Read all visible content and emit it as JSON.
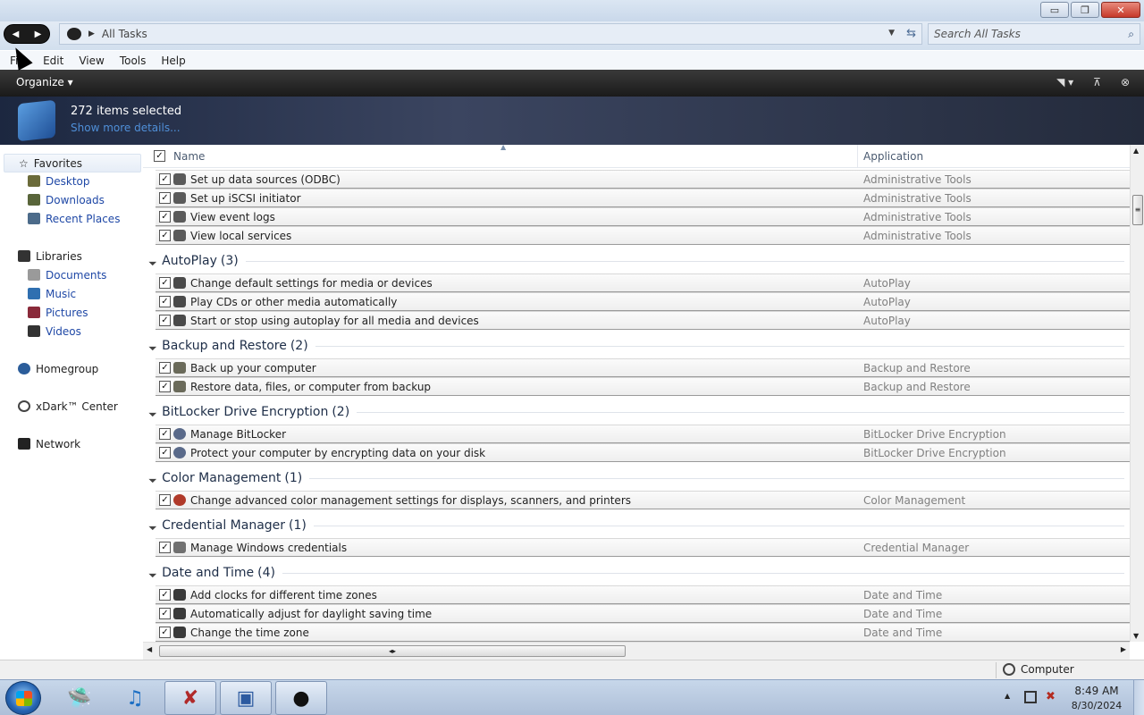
{
  "window": {
    "controls": {
      "minimize": "▭",
      "maximize": "❐",
      "close": "✕"
    }
  },
  "address": {
    "path": "All Tasks",
    "search_placeholder": "Search All Tasks"
  },
  "menu": [
    "File",
    "Edit",
    "View",
    "Tools",
    "Help"
  ],
  "toolbar": {
    "organize": "Organize"
  },
  "details": {
    "count": "272 items selected",
    "more": "Show more details..."
  },
  "sidebar": {
    "favorites": "Favorites",
    "fav_items": [
      "Desktop",
      "Downloads",
      "Recent Places"
    ],
    "libraries": "Libraries",
    "lib_items": [
      "Documents",
      "Music",
      "Pictures",
      "Videos"
    ],
    "homegroup": "Homegroup",
    "xdark": "xDark™ Center",
    "network": "Network"
  },
  "columns": {
    "name": "Name",
    "application": "Application"
  },
  "list": {
    "top_rows": [
      {
        "name": "Set up data sources (ODBC)",
        "app": "Administrative Tools"
      },
      {
        "name": "Set up iSCSI initiator",
        "app": "Administrative Tools"
      },
      {
        "name": "View event logs",
        "app": "Administrative Tools"
      },
      {
        "name": "View local services",
        "app": "Administrative Tools"
      }
    ],
    "groups": [
      {
        "label": "AutoPlay",
        "count": "(3)",
        "rows": [
          {
            "name": "Change default settings for media or devices",
            "app": "AutoPlay"
          },
          {
            "name": "Play CDs or other media automatically",
            "app": "AutoPlay"
          },
          {
            "name": "Start or stop using autoplay for all media and devices",
            "app": "AutoPlay"
          }
        ]
      },
      {
        "label": "Backup and Restore",
        "count": "(2)",
        "rows": [
          {
            "name": "Back up your computer",
            "app": "Backup and Restore"
          },
          {
            "name": "Restore data, files, or computer from backup",
            "app": "Backup and Restore"
          }
        ]
      },
      {
        "label": "BitLocker Drive Encryption",
        "count": "(2)",
        "rows": [
          {
            "name": "Manage BitLocker",
            "app": "BitLocker Drive Encryption"
          },
          {
            "name": "Protect your computer by encrypting data on your disk",
            "app": "BitLocker Drive Encryption"
          }
        ]
      },
      {
        "label": "Color Management",
        "count": "(1)",
        "rows": [
          {
            "name": "Change advanced color management settings for displays, scanners, and printers",
            "app": "Color Management"
          }
        ]
      },
      {
        "label": "Credential Manager",
        "count": "(1)",
        "rows": [
          {
            "name": "Manage Windows credentials",
            "app": "Credential Manager"
          }
        ]
      },
      {
        "label": "Date and Time",
        "count": "(4)",
        "rows": [
          {
            "name": "Add clocks for different time zones",
            "app": "Date and Time"
          },
          {
            "name": "Automatically adjust for daylight saving time",
            "app": "Date and Time"
          },
          {
            "name": "Change the time zone",
            "app": "Date and Time"
          }
        ]
      }
    ]
  },
  "status": {
    "location": "Computer"
  },
  "taskbar": {
    "time": "8:49 AM",
    "date": "8/30/2024"
  }
}
